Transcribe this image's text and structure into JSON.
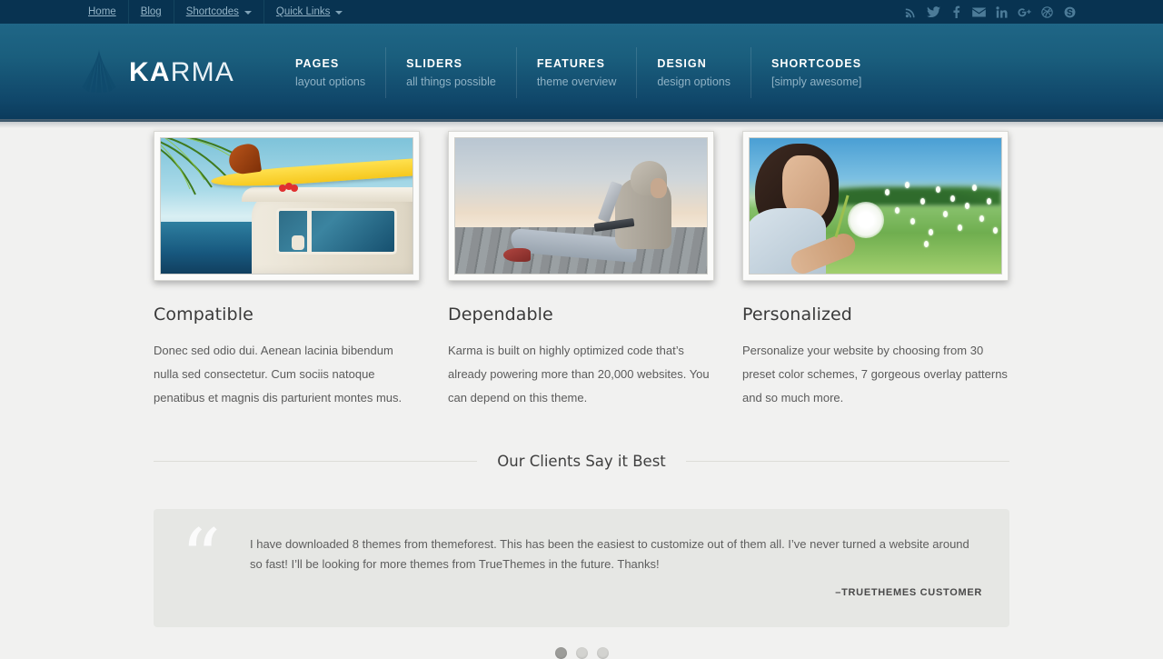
{
  "topbar": {
    "nav": [
      {
        "label": "Home",
        "has_caret": false
      },
      {
        "label": "Blog",
        "has_caret": false
      },
      {
        "label": "Shortcodes",
        "has_caret": true
      },
      {
        "label": "Quick Links",
        "has_caret": true
      }
    ],
    "social": [
      {
        "name": "rss-icon",
        "label": "RSS"
      },
      {
        "name": "twitter-icon",
        "label": "Twitter"
      },
      {
        "name": "facebook-icon",
        "label": "Facebook"
      },
      {
        "name": "email-icon",
        "label": "Email"
      },
      {
        "name": "linkedin-icon",
        "label": "LinkedIn"
      },
      {
        "name": "googleplus-icon",
        "label": "Google Plus"
      },
      {
        "name": "dribbble-icon",
        "label": "Dribbble"
      },
      {
        "name": "skype-icon",
        "label": "Skype"
      }
    ],
    "background_color": "#083351",
    "link_color": "#93b3c6"
  },
  "header": {
    "logo": {
      "bold": "KA",
      "light": "RMA",
      "mark": "fan-shell-logo-icon"
    },
    "background_gradient": [
      "#1f6686",
      "#0b3b5c"
    ],
    "nav": [
      {
        "title": "PAGES",
        "subtitle": "layout options"
      },
      {
        "title": "SLIDERS",
        "subtitle": "all things possible"
      },
      {
        "title": "FEATURES",
        "subtitle": "theme overview"
      },
      {
        "title": "DESIGN",
        "subtitle": "design options"
      },
      {
        "title": "SHORTCODES",
        "subtitle": "[simply awesome]"
      }
    ]
  },
  "cards": [
    {
      "image_name": "surfboard-van-beach-photo",
      "title": "Compatible",
      "body": "Donec sed odio dui. Aenean lacinia bibendum nulla sed consectetur. Cum sociis natoque penatibus et magnis dis parturient montes mus."
    },
    {
      "image_name": "hoodie-laptop-dock-photo",
      "title": "Dependable",
      "body": "Karma is built on highly optimized code that’s already powering more than 20,000 websites. You can depend on this theme."
    },
    {
      "image_name": "girl-dandelion-field-photo",
      "title": "Personalized",
      "body": "Personalize your website by choosing from 30 preset color schemes, 7 gorgeous overlay patterns and so much more."
    }
  ],
  "testimonials_section": {
    "divider_title": "Our Clients Say it Best",
    "quote_glyph": "“",
    "text": "I have downloaded 8 themes from themeforest. This has been the easiest to customize out of them all. I’ve never turned a website around so fast! I’ll be looking for more themes from TrueThemes in the future. Thanks!",
    "author": "–TRUETHEMES CUSTOMER",
    "background_color": "#e6e7e4",
    "dots": [
      {
        "active": true
      },
      {
        "active": false
      },
      {
        "active": false
      }
    ]
  },
  "page": {
    "background_color": "#f1f1f0"
  }
}
